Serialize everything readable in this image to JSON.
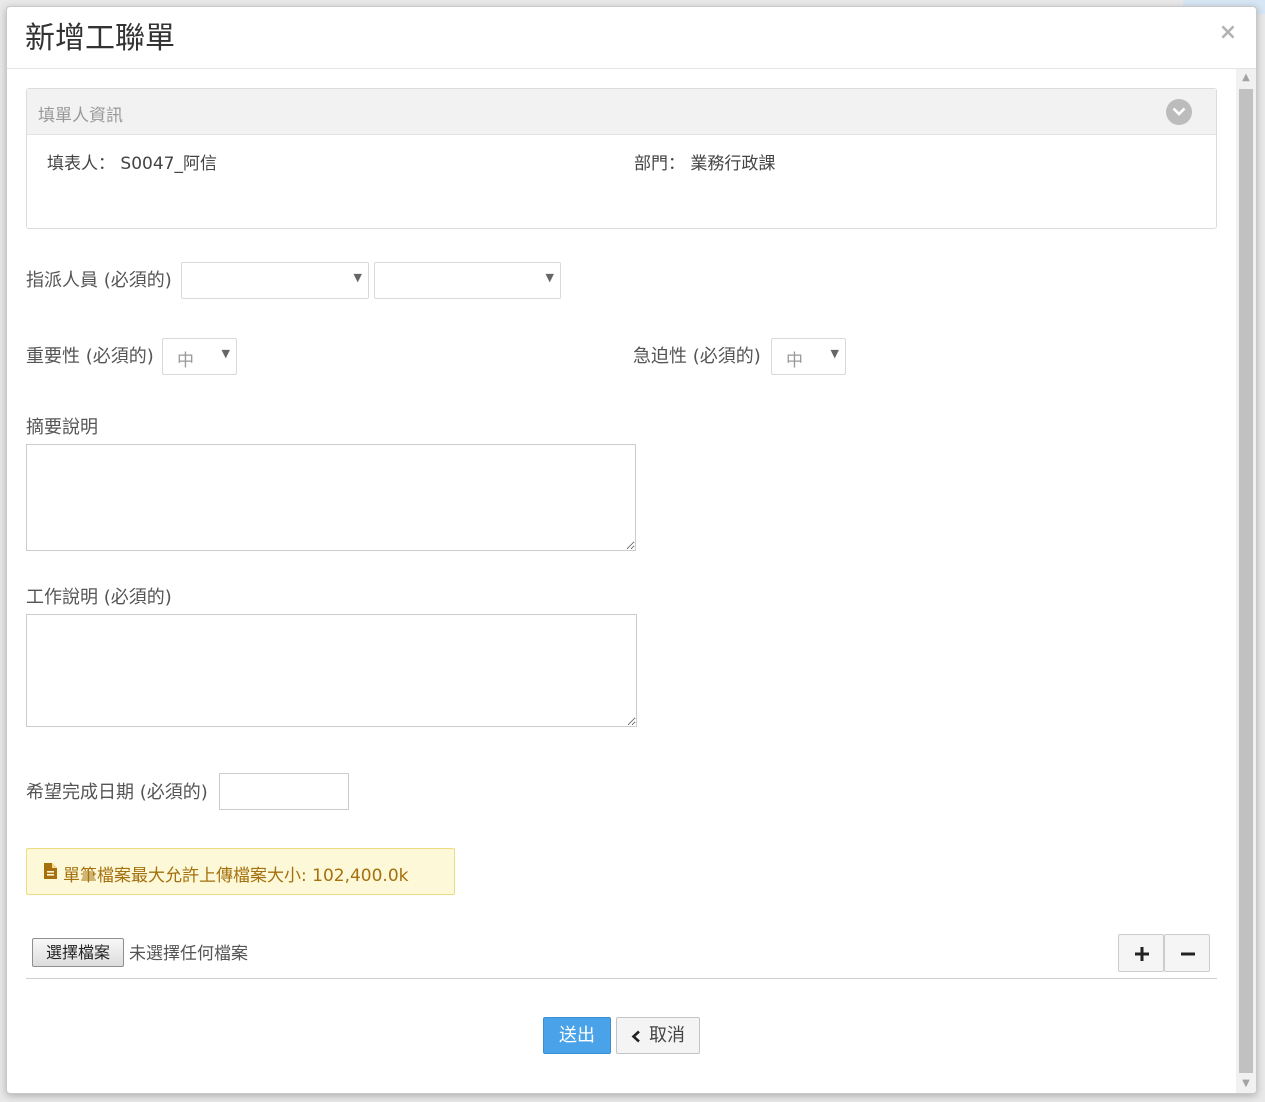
{
  "modal": {
    "title": "新增工聯單",
    "close": "×"
  },
  "filler_panel": {
    "title": "填單人資訊",
    "filler": "填表人： S0047_阿信",
    "department": "部門： 業務行政課"
  },
  "form": {
    "assignee_label": "指派人員 (必須的)",
    "importance_label": "重要性 (必須的)",
    "importance_value": "中",
    "urgency_label": "急迫性 (必須的)",
    "urgency_value": "中",
    "summary_label": "摘要說明",
    "work_label": "工作說明 (必須的)",
    "date_label": "希望完成日期 (必須的)"
  },
  "notice": {
    "text": "單筆檔案最大允許上傳檔案大小: 102,400.0k",
    "color": "#a5700d"
  },
  "upload": {
    "choose_label": "選擇檔案",
    "none_label": "未選擇任何檔案"
  },
  "actions": {
    "submit_label": "送出",
    "cancel_label": "取消",
    "submit_color": "#4aa3e8"
  }
}
